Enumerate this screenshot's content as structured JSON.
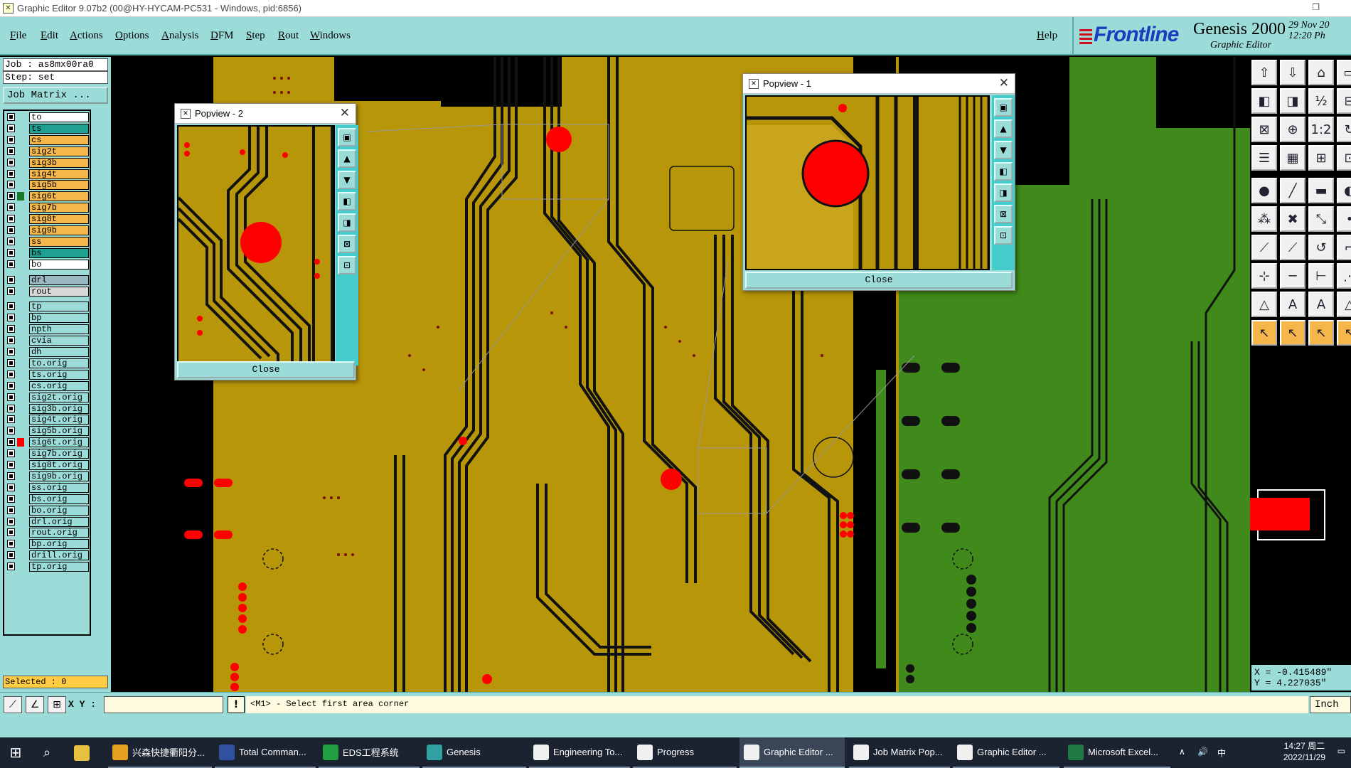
{
  "window": {
    "title": "Graphic Editor 9.07b2 (00@HY-HYCAM-PC531 - Windows, pid:6856)"
  },
  "menu": [
    "File",
    "Edit",
    "Actions",
    "Options",
    "Analysis",
    "DFM",
    "Step",
    "Rout",
    "Windows"
  ],
  "help_label": "Help",
  "logo": {
    "brand": "Frontline",
    "product": "Genesis 2000",
    "subtitle": "Graphic Editor",
    "date": "29 Nov 20",
    "time": "12:20 Ph"
  },
  "left": {
    "job": "Job : as8mx00ra0",
    "step": "Step: set",
    "job_matrix": "Job Matrix ...",
    "selected": "Selected : 0"
  },
  "layers_board": [
    {
      "name": "to",
      "color": "#ffffff",
      "state": "white"
    },
    {
      "name": "ts",
      "color": "#20a090",
      "state": "teal"
    },
    {
      "name": "cs",
      "color": "#f5b64a",
      "state": "orange"
    },
    {
      "name": "sig2t",
      "color": "#f5b64a",
      "state": "orange"
    },
    {
      "name": "sig3b",
      "color": "#f5b64a",
      "state": "orange"
    },
    {
      "name": "sig4t",
      "color": "#f5b64a",
      "state": "orange"
    },
    {
      "name": "sig5b",
      "color": "#f5b64a",
      "state": "orange"
    },
    {
      "name": "sig6t",
      "color": "#f5b64a",
      "state": "orange",
      "selected": true
    },
    {
      "name": "sig7b",
      "color": "#f5b64a",
      "state": "orange"
    },
    {
      "name": "sig8t",
      "color": "#f5b64a",
      "state": "orange"
    },
    {
      "name": "sig9b",
      "color": "#f5b64a",
      "state": "orange"
    },
    {
      "name": "ss",
      "color": "#f5b64a",
      "state": "orange"
    },
    {
      "name": "bs",
      "color": "#20a090",
      "state": "teal"
    },
    {
      "name": "bo",
      "color": "#ffffff",
      "state": "white"
    }
  ],
  "layers_drill": [
    {
      "name": "drl",
      "color": "#9ab8c0"
    },
    {
      "name": "rout",
      "color": "#d8d8d8"
    }
  ],
  "layers_misc": [
    {
      "name": "tp"
    },
    {
      "name": "bp"
    },
    {
      "name": "npth"
    },
    {
      "name": "cvia"
    },
    {
      "name": "dh"
    },
    {
      "name": "to.orig"
    },
    {
      "name": "ts.orig"
    },
    {
      "name": "cs.orig"
    },
    {
      "name": "sig2t.orig"
    },
    {
      "name": "sig3b.orig"
    },
    {
      "name": "sig4t.orig"
    },
    {
      "name": "sig5b.orig"
    },
    {
      "name": "sig6t.orig",
      "marker": "#ff0000"
    },
    {
      "name": "sig7b.orig"
    },
    {
      "name": "sig8t.orig"
    },
    {
      "name": "sig9b.orig"
    },
    {
      "name": "ss.orig"
    },
    {
      "name": "bs.orig"
    },
    {
      "name": "bo.orig"
    },
    {
      "name": "drl.orig"
    },
    {
      "name": "rout.orig"
    },
    {
      "name": "bp.orig"
    },
    {
      "name": "drill.orig"
    },
    {
      "name": "tp.orig"
    }
  ],
  "popview1": {
    "title": "Popview - 1",
    "close": "Close"
  },
  "popview2": {
    "title": "Popview - 2",
    "close": "Close"
  },
  "coords": {
    "x": "X = -0.415489\"",
    "y": "Y = 4.227035\""
  },
  "status": {
    "xy_label": "X Y :",
    "xy_value": "",
    "message": "<M1> - Select first area corner",
    "units": "Inch"
  },
  "taskbar": [
    {
      "label": "兴森快捷衢阳分...",
      "icon": "#e8a020"
    },
    {
      "label": "Total Comman...",
      "icon": "#3050a0"
    },
    {
      "label": "EDS工程系统",
      "icon": "#20a040"
    },
    {
      "label": "Genesis",
      "icon": "#30a0a0"
    },
    {
      "label": "Engineering To...",
      "icon": "#f0f0f0"
    },
    {
      "label": "Progress",
      "icon": "#f0f0f0"
    },
    {
      "label": "Graphic Editor ...",
      "icon": "#f0f0f0",
      "active": true
    },
    {
      "label": "Job Matrix Pop...",
      "icon": "#f0f0f0"
    },
    {
      "label": "Graphic Editor ...",
      "icon": "#f0f0f0"
    },
    {
      "label": "Microsoft Excel...",
      "icon": "#1e7a40"
    }
  ],
  "tray": {
    "ime": "中",
    "time": "14:27 周二",
    "date": "2022/11/29"
  },
  "colors": {
    "panel": "#9bdcd8",
    "copper": "#b8960a",
    "green": "#3f8a1a",
    "pad": "#ff0000"
  }
}
